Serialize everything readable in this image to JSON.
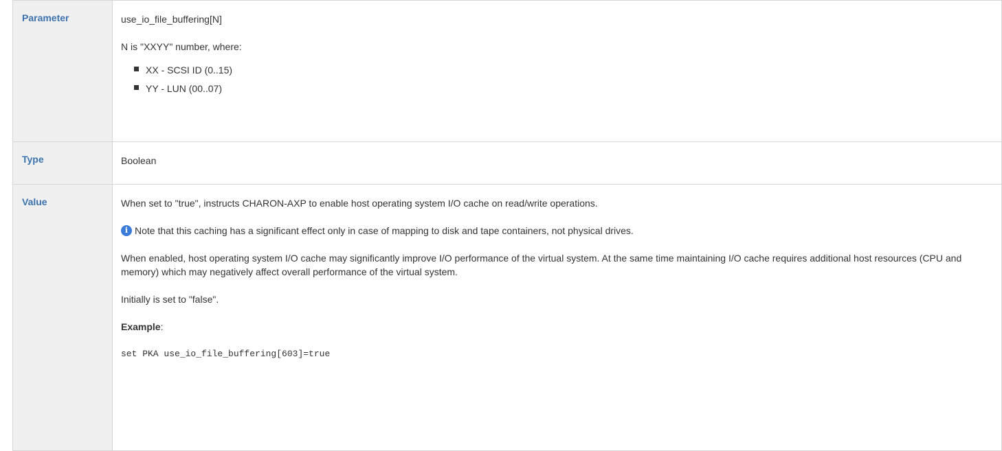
{
  "table": {
    "rows": {
      "parameter": {
        "label": "Parameter",
        "name": "use_io_file_buffering[N]",
        "description": "N is \"XXYY\" number, where:",
        "bullets": [
          "XX - SCSI ID (0..15)",
          "YY - LUN (00..07)"
        ]
      },
      "type": {
        "label": "Type",
        "value": "Boolean"
      },
      "value": {
        "label": "Value",
        "p1": "When set to \"true\", instructs CHARON-AXP to enable host operating system I/O cache on read/write operations.",
        "note": "Note that this caching has a significant effect only in case of mapping to disk and tape containers, not physical drives.",
        "note_icon": "info-icon",
        "p2": "When enabled, host operating system I/O cache may significantly improve I/O performance of the virtual system. At the same time maintaining I/O cache requires additional host resources (CPU and memory) which may negatively affect overall performance of the virtual system.",
        "p3": "Initially is set to \"false\".",
        "example_label": "Example",
        "example_colon": ":",
        "code": "set PKA use_io_file_buffering[603]=true"
      }
    }
  },
  "colors": {
    "header_text": "#3b73af",
    "header_bg": "#f0f0f0",
    "border": "#d7d7d7",
    "info_icon": "#3b7dd8"
  }
}
